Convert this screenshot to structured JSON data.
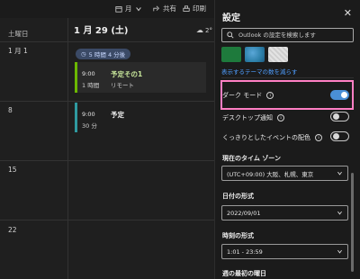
{
  "toolbar": {
    "view_label": "月",
    "share_label": "共有",
    "print_label": "印刷"
  },
  "calendar": {
    "day_column_header": "土曜日",
    "date_header": "1 月 29 (土)",
    "weather": "2°",
    "weeks": [
      "1 月 1",
      "8",
      "15",
      "22"
    ],
    "reminder_pill": "5 時間 4 分後",
    "events": [
      {
        "time": "9:00",
        "duration": "1 時間",
        "title": "予定その1",
        "subtitle": "リモート",
        "color": "#6bb700",
        "title_color": "#c7e59a"
      },
      {
        "time": "9:00",
        "duration": "30 分",
        "title": "予定",
        "subtitle": "",
        "color": "#2f9aa0",
        "title_color": "#f0f0f0"
      }
    ]
  },
  "settings": {
    "title": "設定",
    "search_placeholder": "Outlook の設定を検索します",
    "theme_colors": [
      "#1e7a3c",
      "#2c7fa8",
      "#e3e3e3"
    ],
    "theme_link": "表示するテーマの数を減らす",
    "dark_mode": {
      "label": "ダーク モード",
      "on": true
    },
    "desktop_notifications": {
      "label": "デスクトップ通知",
      "on": false
    },
    "event_colors": {
      "label": "くっきりとしたイベントの配色",
      "on": false
    },
    "timezone": {
      "label": "現在のタイム ゾーン",
      "value": "(UTC+09:00) 大阪、札幌、東京"
    },
    "date_format": {
      "label": "日付の形式",
      "value": "2022/09/01"
    },
    "time_format": {
      "label": "時刻の形式",
      "value": "1:01 - 23:59"
    },
    "week_start": {
      "label": "週の最初の曜日"
    }
  },
  "colors": {
    "accent": "#4a8fd6",
    "highlight_box": "#ff7fc4",
    "link": "#4f9eff"
  }
}
